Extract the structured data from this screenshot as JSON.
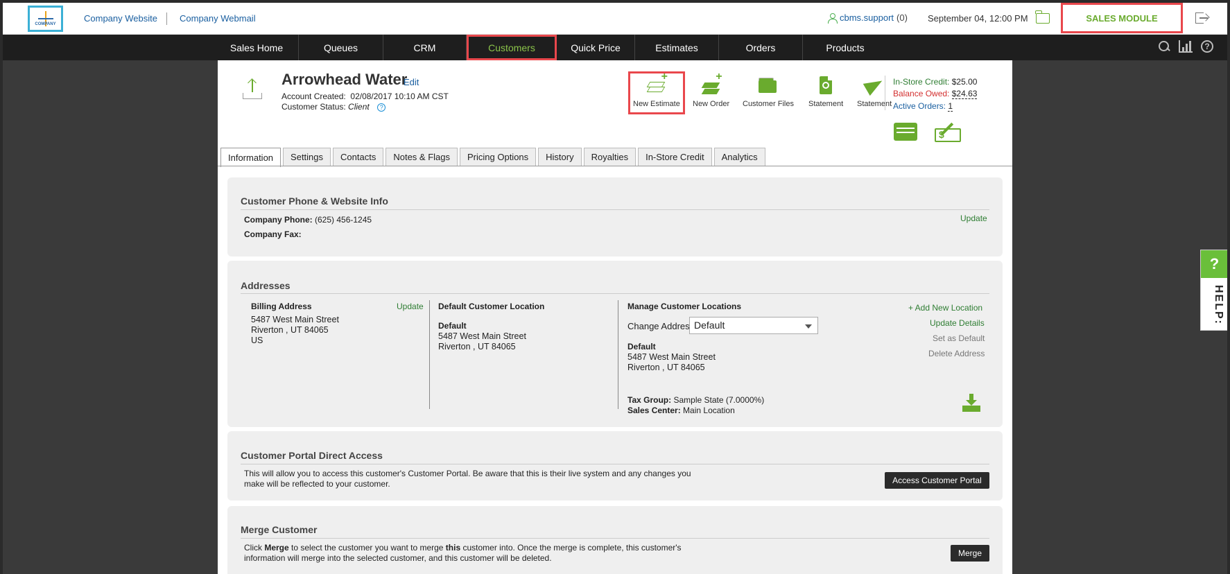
{
  "topbar": {
    "logo_text": "COMPANY",
    "links": [
      "Company Website",
      "Company Webmail"
    ],
    "user": "cbms.support",
    "user_count": "(0)",
    "datetime": "September 04, 12:00 PM",
    "module": "SALES MODULE"
  },
  "nav": {
    "items": [
      "Sales Home",
      "Queues",
      "CRM",
      "Customers",
      "Quick Price",
      "Estimates",
      "Orders",
      "Products"
    ],
    "active": "Customers"
  },
  "customer": {
    "name": "Arrowhead Water",
    "edit_label": "Edit",
    "account_created_label": "Account Created:",
    "account_created_value": "02/08/2017 10:10 AM CST",
    "status_label": "Customer Status:",
    "status_value": "Client"
  },
  "actions": [
    "New Estimate",
    "New Order",
    "Customer Files",
    "Statement",
    "Statement"
  ],
  "credit": {
    "instore_label": "In-Store Credit:",
    "instore_value": "$25.00",
    "balance_label": "Balance Owed:",
    "balance_value": "$24.63",
    "active_label": "Active Orders:",
    "active_value": "1"
  },
  "tabs": [
    "Information",
    "Settings",
    "Contacts",
    "Notes & Flags",
    "Pricing Options",
    "History",
    "Royalties",
    "In-Store Credit",
    "Analytics"
  ],
  "phone_panel": {
    "title": "Customer Phone & Website Info",
    "phone_label": "Company Phone:",
    "phone_value": "(625) 456-1245",
    "fax_label": "Company Fax:",
    "update": "Update"
  },
  "addresses": {
    "title": "Addresses",
    "billing_title": "Billing Address",
    "billing_update": "Update",
    "billing_lines": [
      "5487 West Main Street",
      "Riverton , UT 84065",
      "US"
    ],
    "default_title": "Default Customer Location",
    "default_name": "Default",
    "default_lines": [
      "5487 West Main Street",
      "Riverton , UT 84065"
    ],
    "manage_title": "Manage Customer Locations",
    "change_label": "Change Address:",
    "change_value": "Default",
    "manage_name": "Default",
    "manage_lines": [
      "5487 West Main Street",
      "Riverton , UT 84065"
    ],
    "tax_label": "Tax Group:",
    "tax_value": "Sample State (7.0000%)",
    "center_label": "Sales Center:",
    "center_value": "Main Location",
    "add_location": "+ Add New Location",
    "update_details": "Update Details",
    "set_default": "Set as Default",
    "delete_address": "Delete Address"
  },
  "portal": {
    "title": "Customer Portal Direct Access",
    "text1": "This will allow you to access this customer's Customer Portal. Be aware that this is their live system and any changes you",
    "text2": "make will be reflected to your customer.",
    "button": "Access Customer Portal"
  },
  "merge": {
    "title": "Merge Customer",
    "t1a": "Click ",
    "t1b": "Merge",
    "t1c": " to select the customer you want to merge ",
    "t1d": "this",
    "t1e": " customer into. Once the merge is complete, this customer's",
    "text2": "information will merge into the selected customer, and this customer will be deleted.",
    "button": "Merge"
  },
  "help": {
    "q": "?",
    "label": "HELP:"
  },
  "colors": {
    "accent_green": "#6aab2e",
    "highlight_red": "#e9474c",
    "nav_bg": "#1e1e1e"
  }
}
